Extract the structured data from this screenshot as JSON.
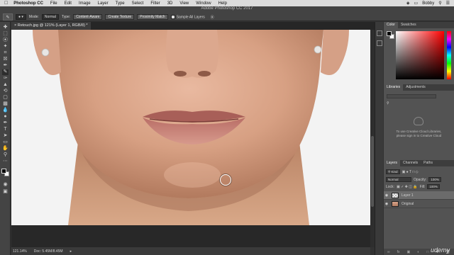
{
  "menubar": {
    "apple": "",
    "app": "Photoshop CC",
    "items": [
      "File",
      "Edit",
      "Image",
      "Layer",
      "Type",
      "Select",
      "Filter",
      "3D",
      "View",
      "Window",
      "Help"
    ],
    "user": "Bobby"
  },
  "window": {
    "title": "Adobe Photoshop CC 2017"
  },
  "options": {
    "mode_label": "Mode:",
    "mode_value": "Normal",
    "type_label": "Type:",
    "type_content_aware": "Content-Aware",
    "type_create_texture": "Create Texture",
    "type_proximity_match": "Proximity Match",
    "sample_all_layers": "Sample All Layers"
  },
  "document": {
    "tab": "Retouch.jpg @ 121% (Layer 1, RGB/8) *"
  },
  "status": {
    "zoom": "121.14%",
    "doc": "Doc: 5.45M/8.45M"
  },
  "panels": {
    "color_tab": "Color",
    "swatches_tab": "Swatches",
    "libraries_tab": "Libraries",
    "adjustments_tab": "Adjustments",
    "libraries_msg_1": "To use Creative Cloud Libraries,",
    "libraries_msg_2": "please sign in to Creative Cloud",
    "layers_tab": "Layers",
    "channels_tab": "Channels",
    "paths_tab": "Paths",
    "kind": "Kind",
    "blend": "Normal",
    "opacity_label": "Opacity:",
    "opacity": "100%",
    "lock_label": "Lock:",
    "fill_label": "Fill:",
    "fill": "100%",
    "layers": [
      {
        "name": "Layer 1",
        "selected": true
      },
      {
        "name": "Original",
        "selected": false
      }
    ]
  },
  "watermark": "udemy",
  "colors": {
    "accent_red": "#ff0000",
    "panel_bg": "#535353",
    "app_bg": "#323232"
  }
}
